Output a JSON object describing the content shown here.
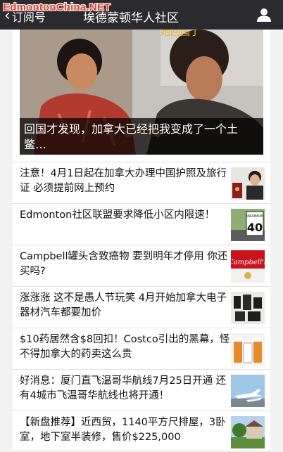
{
  "watermark": "EdmontonChina.NET",
  "nav": {
    "back_label": "订阅号",
    "title": "埃德蒙顿华人社区"
  },
  "hero": {
    "caption": "回国才发现，加拿大已经把我变成了一个土鳖…",
    "image_text": "她回国了"
  },
  "articles": [
    {
      "title": "注意！4月1日起在加拿大办理中国护照及旅行证 必须提前网上预约",
      "thumb": "passport-photo"
    },
    {
      "title": "Edmonton社区联盟要求降低小区内限速！",
      "thumb": "speed-limit-sign",
      "sign_top": "MAXIMUM",
      "sign_value": "40"
    },
    {
      "title": "Campbell罐头含致癌物 要到明年才停用 你还买吗?",
      "thumb": "campbells-cans",
      "brand": "Campbell's"
    },
    {
      "title": "涨涨涨 这不是愚人节玩笑 4月开始加拿大电子器材汽车都要加价",
      "thumb": "camera-lenses"
    },
    {
      "title": "$10药居然含$8回扣！Costco引出的黑幕，怪不得加拿大的药卖这么贵",
      "thumb": "medicine-bottles"
    },
    {
      "title": "好消息：厦门直飞温哥华航线7月25日开通 还有4城市飞温哥华航线也将开通！",
      "thumb": "airplanes"
    },
    {
      "title": "【新盘推荐】近西贸，1140平方尺排屋，3卧室，地下室半装修，售价$225,000",
      "thumb": "townhouse"
    }
  ]
}
